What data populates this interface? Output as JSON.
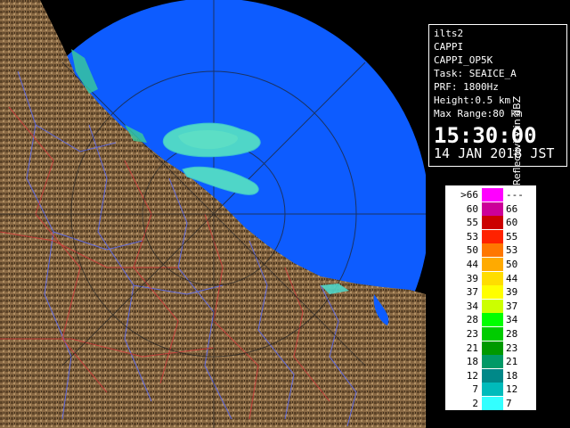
{
  "panel": {
    "station": "ilts2",
    "product": "CAPPI",
    "product_code": "CAPPI_OP5K",
    "task": "Task: SEAICE_A",
    "prf": "PRF: 1800Hz",
    "height": "Height:0.5 km",
    "max_range": "Max Range:80 km",
    "time": "15:30:00",
    "date": "14 JAN 2018 JST"
  },
  "legend": {
    "title": "Reflectivity in dBZ",
    "rows": [
      {
        "lo": ">66",
        "hi": "---",
        "color": "#ff00ff"
      },
      {
        "lo": "60",
        "hi": "66",
        "color": "#cc0099"
      },
      {
        "lo": "55",
        "hi": "60",
        "color": "#cc0000"
      },
      {
        "lo": "53",
        "hi": "55",
        "color": "#ff2200"
      },
      {
        "lo": "50",
        "hi": "53",
        "color": "#ff7700"
      },
      {
        "lo": "44",
        "hi": "50",
        "color": "#ffaa00"
      },
      {
        "lo": "39",
        "hi": "44",
        "color": "#ffdd00"
      },
      {
        "lo": "37",
        "hi": "39",
        "color": "#ffff00"
      },
      {
        "lo": "34",
        "hi": "37",
        "color": "#ccff00"
      },
      {
        "lo": "28",
        "hi": "34",
        "color": "#00ff00"
      },
      {
        "lo": "23",
        "hi": "28",
        "color": "#00cc00"
      },
      {
        "lo": "21",
        "hi": "23",
        "color": "#009900"
      },
      {
        "lo": "18",
        "hi": "21",
        "color": "#009966"
      },
      {
        "lo": "12",
        "hi": "18",
        "color": "#008888"
      },
      {
        "lo": "7",
        "hi": "12",
        "color": "#00bbbb"
      },
      {
        "lo": "2",
        "hi": "7",
        "color": "#33ffff"
      }
    ]
  },
  "map": {
    "sea_color": "#0d5cff",
    "land_color": "#8a6a45",
    "echo_color": "#4fd6c8"
  }
}
